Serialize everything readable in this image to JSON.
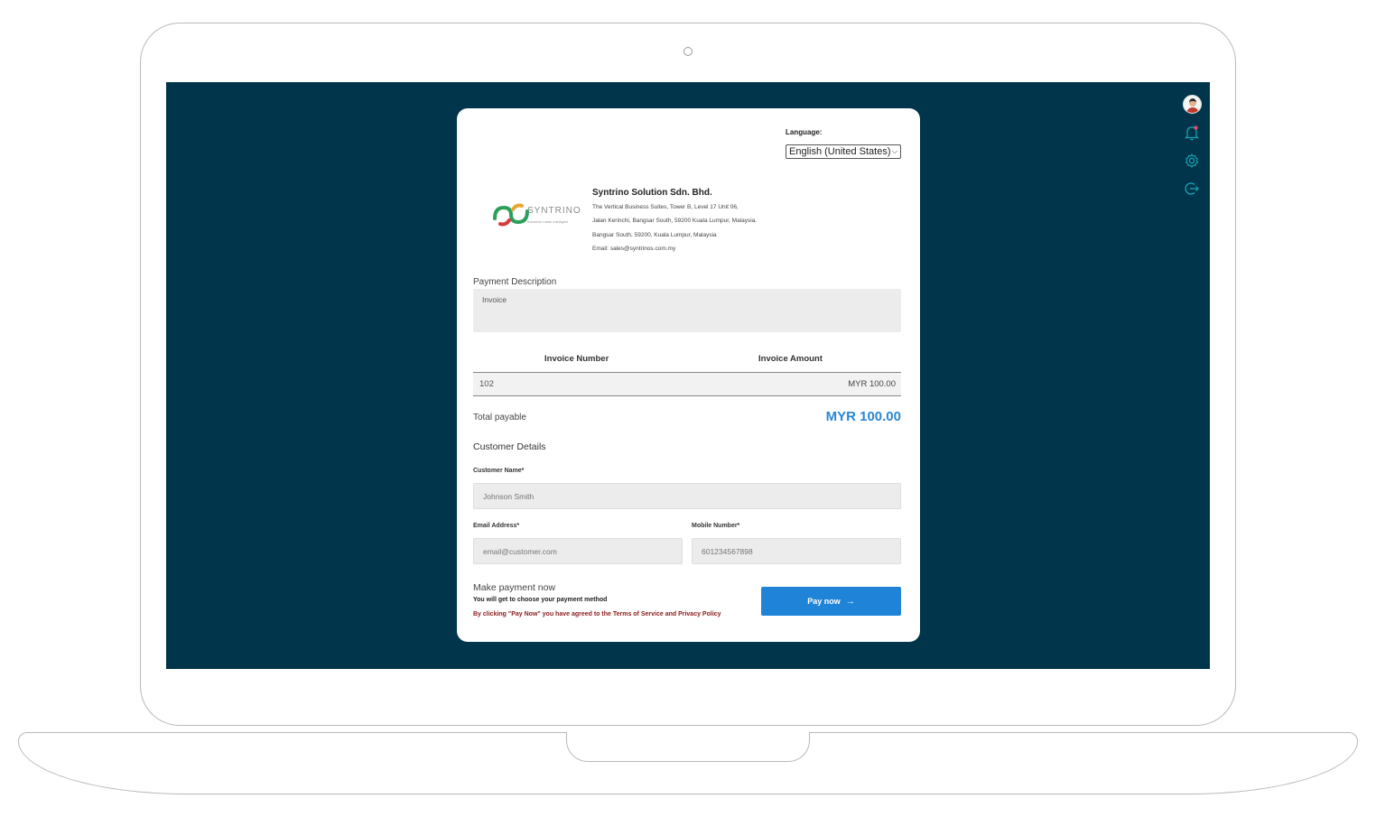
{
  "language": {
    "label": "Language:",
    "selected": "English (United States)"
  },
  "company": {
    "logo_text": "SYNTRINO",
    "logo_tagline": "Business made intelligent",
    "name": "Syntrino Solution Sdn. Bhd.",
    "address_line1": "The Vertical Business Suites, Tower B, Level 17 Unit 06,",
    "address_line2": "Jalan Kerinchi, Bangsar South, 59200 Kuala Lumpur, Malaysia.",
    "address_line3": "Bangsar South, 59200, Kuala Lumpur, Malaysia",
    "email_line": "Email: sales@syntrinos.com.my"
  },
  "payment_description": {
    "label": "Payment Description",
    "value": "Invoice"
  },
  "invoice_table": {
    "columns": [
      "Invoice Number",
      "Invoice Amount"
    ],
    "rows": [
      {
        "number": "102",
        "amount": "MYR 100.00"
      }
    ]
  },
  "total": {
    "label": "Total payable",
    "value": "MYR 100.00"
  },
  "customer": {
    "heading": "Customer Details",
    "name_label": "Customer Name*",
    "name_placeholder": "Johnson Smith",
    "email_label": "Email Address*",
    "email_placeholder": "email@customer.com",
    "mobile_label": "Mobile Number*",
    "mobile_placeholder": "601234567898"
  },
  "payment": {
    "heading": "Make payment now",
    "subtext": "You will get to choose your payment method",
    "terms": "By clicking \"Pay Now\" you have agreed to the Terms of Service and Privacy Policy",
    "button_label": "Pay now",
    "button_icon": "arrow-right-icon"
  },
  "toolbar": {
    "icons": [
      "avatar",
      "bell-icon",
      "gear-icon",
      "logout-icon"
    ]
  },
  "colors": {
    "screen_bg": "#00354b",
    "accent_blue": "#1f84d8",
    "total_blue": "#2a87d2",
    "terms_red": "#8b1a1a",
    "toolbar_teal": "#1aa6b7",
    "bell_dot": "#e8476a"
  }
}
